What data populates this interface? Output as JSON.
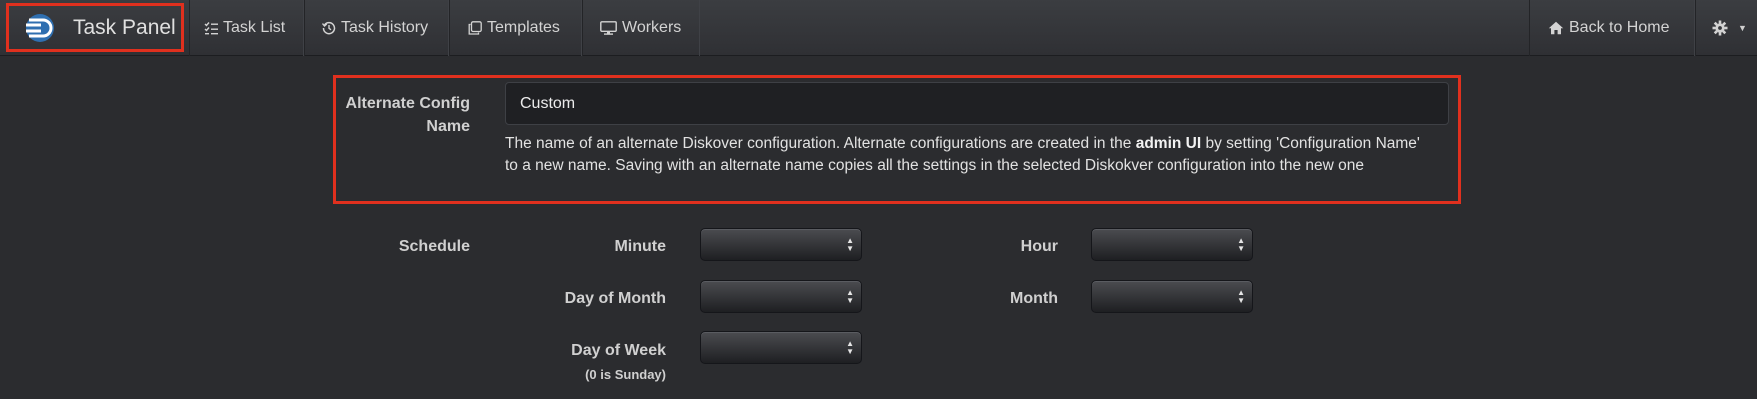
{
  "navbar": {
    "brand": "Task Panel",
    "items": [
      {
        "label": "Task List",
        "icon": "list-check-icon"
      },
      {
        "label": "Task History",
        "icon": "history-icon"
      },
      {
        "label": "Templates",
        "icon": "copy-icon"
      },
      {
        "label": "Workers",
        "icon": "monitor-icon"
      }
    ],
    "back_home": "Back to Home",
    "settings_icon": "gear-icon"
  },
  "form": {
    "alt_config": {
      "label": "Alternate Config Name",
      "value": "Custom",
      "help_before": "The name of an alternate Diskover configuration. Alternate configurations are created in the ",
      "help_bold": "admin UI",
      "help_after": " by setting 'Configuration Name' to a new name. Saving with an alternate name copies all the settings in the selected Diskokver configuration into the new one"
    },
    "schedule": {
      "label": "Schedule",
      "minute": "Minute",
      "hour": "Hour",
      "day_of_month": "Day of Month",
      "month": "Month",
      "day_of_week": "Day of Week",
      "day_of_week_note": "(0 is Sunday)"
    }
  },
  "colors": {
    "highlight": "#e0301e",
    "background": "#2b2c2f",
    "brand_blue": "#3a8fd6"
  }
}
